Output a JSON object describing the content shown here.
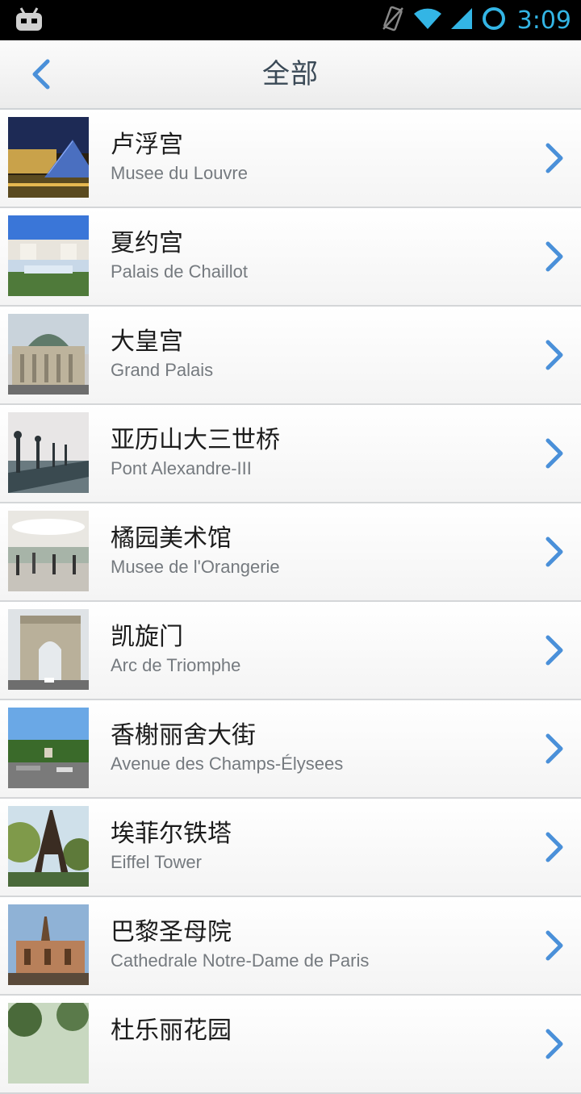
{
  "status_bar": {
    "time": "3:09"
  },
  "header": {
    "title": "全部"
  },
  "places": [
    {
      "zh": "卢浮宫",
      "en": "Musee du Louvre"
    },
    {
      "zh": "夏约宫",
      "en": "Palais de Chaillot"
    },
    {
      "zh": "大皇宫",
      "en": "Grand Palais"
    },
    {
      "zh": "亚历山大三世桥",
      "en": "Pont Alexandre-III"
    },
    {
      "zh": "橘园美术馆",
      "en": "Musee de l'Orangerie"
    },
    {
      "zh": "凯旋门",
      "en": "Arc de Triomphe"
    },
    {
      "zh": "香榭丽舍大街",
      "en": "Avenue des Champs-Élysees"
    },
    {
      "zh": "埃菲尔铁塔",
      "en": "Eiffel Tower"
    },
    {
      "zh": "巴黎圣母院",
      "en": "Cathedrale Notre-Dame de Paris"
    },
    {
      "zh": "杜乐丽花园",
      "en": ""
    }
  ],
  "colors": {
    "accent": "#33b5e5",
    "chevron": "#4a90d9"
  }
}
